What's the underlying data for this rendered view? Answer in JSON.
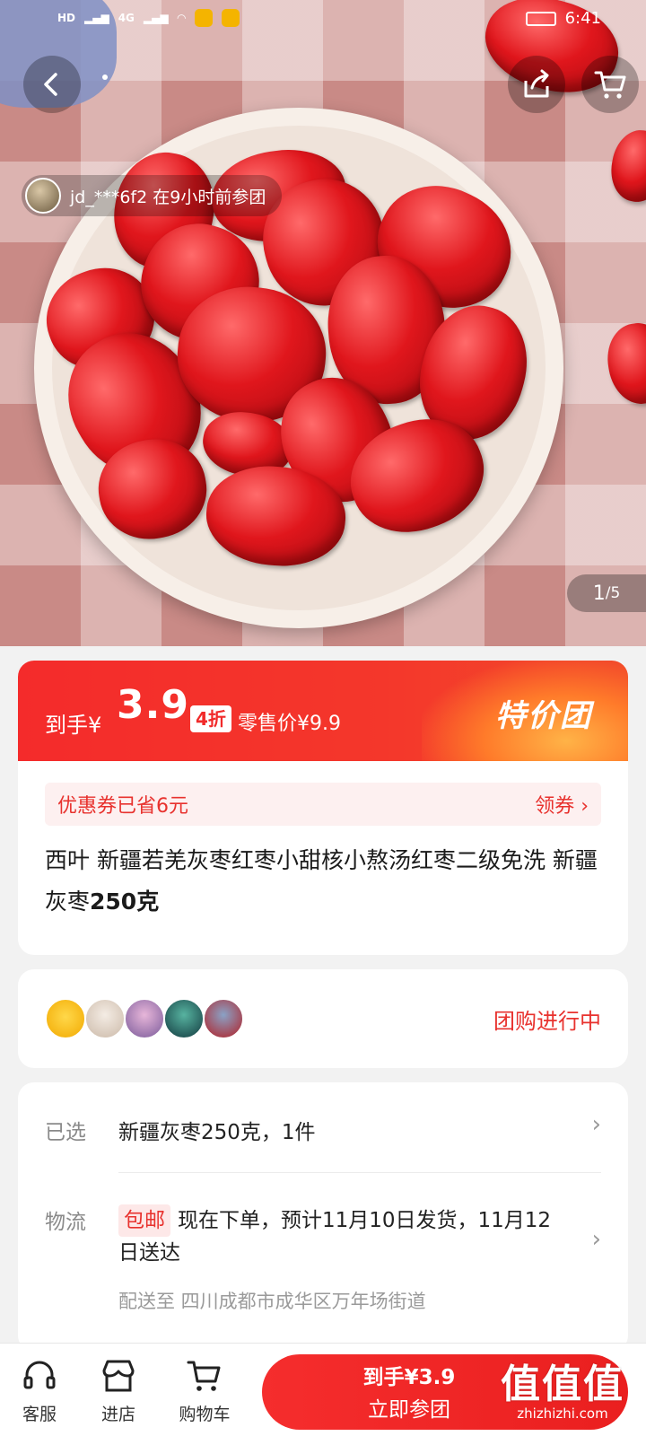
{
  "status_bar": {
    "time": "6:41",
    "network": "4G"
  },
  "gallery": {
    "joiner_text": "jd_***6f2  在9小时前参团",
    "counter_current": "1",
    "counter_total": "/5"
  },
  "price": {
    "label": "到手¥",
    "amount": "3.9",
    "discount": "4折",
    "retail": "零售价¥9.9",
    "promo_tag": "特价团"
  },
  "coupon": {
    "text": "优惠券已省6元",
    "action": "领券 ›"
  },
  "product": {
    "title_part1": "西叶 新疆若羌灰枣红枣小甜核小熬汤红枣二级免洗 新疆灰枣",
    "title_bold": "250克"
  },
  "group": {
    "status": "团购进行中",
    "avatar_colors": [
      "#f7c31b",
      "#e6d6c8",
      "#c9a0c7",
      "#2f6a5e",
      "#b23a3a"
    ]
  },
  "selection": {
    "label": "已选",
    "value": "新疆灰枣250克，1件"
  },
  "shipping": {
    "label": "物流",
    "badge": "包邮",
    "text": "现在下单，预计11月10日发货，11月12日送达",
    "deliver_to": "配送至  四川成都市成华区万年场街道"
  },
  "bottom_bar": {
    "service": "客服",
    "store": "进店",
    "cart": "购物车",
    "buy_line1": "到手¥3.9",
    "buy_line2": "立即参团"
  },
  "watermark": {
    "big": "值值值",
    "small": "zhizhizhi.com"
  },
  "colors": {
    "accent": "#f42b2b",
    "text_red": "#e8322e"
  }
}
